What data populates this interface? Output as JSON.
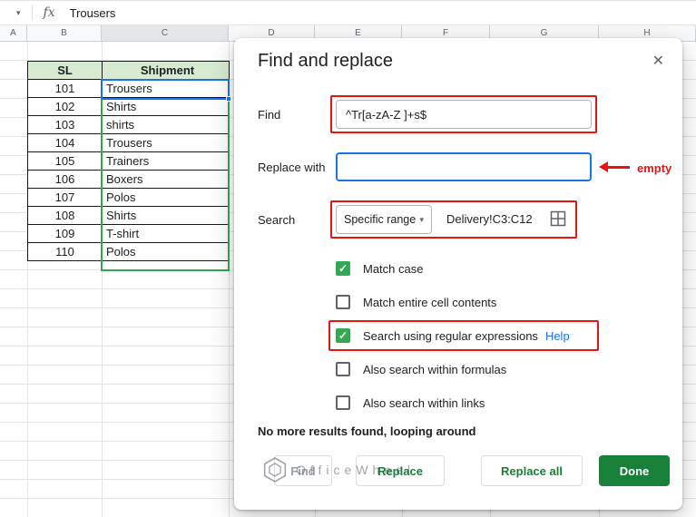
{
  "formula_bar": {
    "fx_label": "fx",
    "value": "Trousers"
  },
  "grid": {
    "column_headers": [
      "A",
      "B",
      "C",
      "D",
      "E",
      "F",
      "G",
      "H"
    ],
    "active_cell": "C3",
    "table": {
      "headers": [
        "SL",
        "Shipment"
      ],
      "rows": [
        {
          "sl": "101",
          "shipment": "Trousers"
        },
        {
          "sl": "102",
          "shipment": "Shirts"
        },
        {
          "sl": "103",
          "shipment": "shirts"
        },
        {
          "sl": "104",
          "shipment": "Trousers"
        },
        {
          "sl": "105",
          "shipment": "Trainers"
        },
        {
          "sl": "106",
          "shipment": "Boxers"
        },
        {
          "sl": "107",
          "shipment": "Polos"
        },
        {
          "sl": "108",
          "shipment": "Shirts"
        },
        {
          "sl": "109",
          "shipment": "T-shirt"
        },
        {
          "sl": "110",
          "shipment": "Polos"
        }
      ]
    }
  },
  "dialog": {
    "title": "Find and replace",
    "find": {
      "label": "Find",
      "value": "^Tr[a-zA-Z ]+s$"
    },
    "replace": {
      "label": "Replace with",
      "value": ""
    },
    "search": {
      "label": "Search",
      "mode": "Specific range",
      "range": "Delivery!C3:C12"
    },
    "checkboxes": [
      {
        "label": "Match case",
        "checked": true
      },
      {
        "label": "Match entire cell contents",
        "checked": false
      },
      {
        "label": "Search using regular expressions",
        "checked": true,
        "help_label": "Help"
      },
      {
        "label": "Also search within formulas",
        "checked": false
      },
      {
        "label": "Also search within links",
        "checked": false
      }
    ],
    "status": "No more results found, looping around",
    "buttons": {
      "find": "Find",
      "replace": "Replace",
      "replace_all": "Replace all",
      "done": "Done"
    }
  },
  "annotations": {
    "empty_label": "empty",
    "color": "#e81313"
  },
  "watermark": {
    "text": "OfficeWheel"
  },
  "icons": {
    "close": "✕",
    "caret_down": "▾",
    "check": "✓"
  },
  "colors": {
    "accent_green": "#188038",
    "checkbox_green": "#34a853",
    "link_blue": "#1a73e8",
    "active_cell_blue": "#1a73e8",
    "table_header_bg": "#d9ead3",
    "annotation_red": "#e81313"
  }
}
